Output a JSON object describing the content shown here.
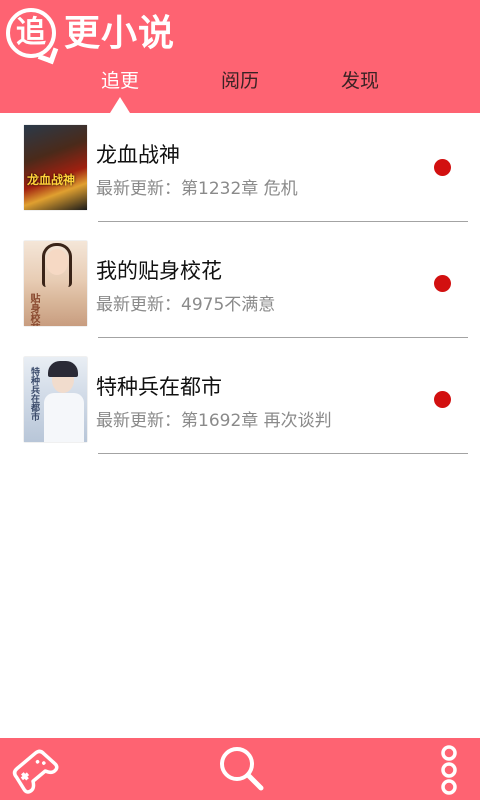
{
  "app": {
    "logo_badge": "追",
    "logo_text": "更小说"
  },
  "tabs": [
    {
      "label": "追更",
      "active": true
    },
    {
      "label": "阅历",
      "active": false
    },
    {
      "label": "发现",
      "active": false
    }
  ],
  "books": [
    {
      "title": "龙血战神",
      "update": "最新更新：第1232章 危机",
      "cover_text": "龙血战神",
      "has_new": true
    },
    {
      "title": "我的贴身校花",
      "update": "最新更新：4975不满意",
      "cover_text": "贴身校花",
      "has_new": true
    },
    {
      "title": "特种兵在都市",
      "update": "最新更新：第1692章  再次谈判",
      "cover_text": "特种兵在都市",
      "has_new": true
    }
  ],
  "footer": {
    "left_icon": "gamepad-icon",
    "center_icon": "search-icon",
    "right_icon": "more-vertical-icon"
  },
  "colors": {
    "primary": "#fe6372",
    "new_indicator": "#d21010"
  }
}
